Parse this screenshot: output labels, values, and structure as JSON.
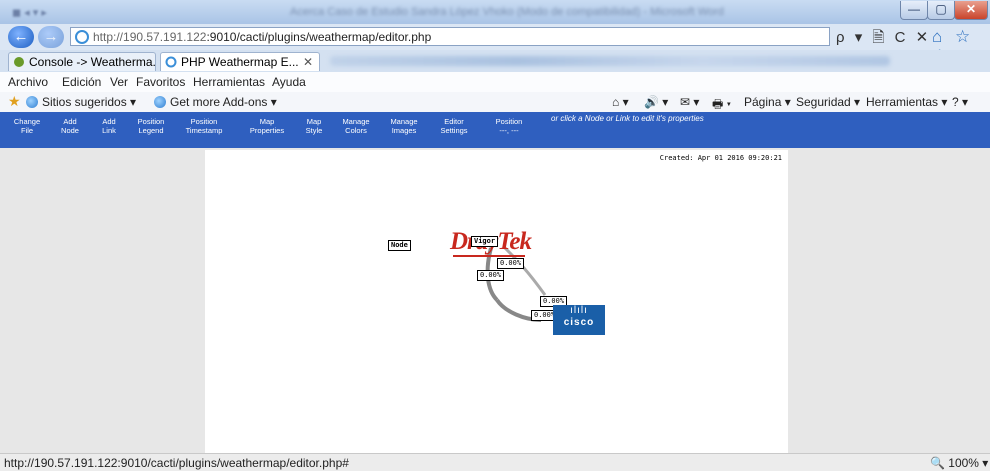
{
  "browser": {
    "tab_title_blurred": "Acerca Caso de Estudio Sandra López Vhoko (Modo de compatibilidad) - Microsoft Word",
    "url_host": "http://190.57.191.122",
    "url_path": ":9010/cacti/plugins/weathermap/editor.php",
    "window_buttons": {
      "minimize": "—",
      "maximize": "▢",
      "close": "✕"
    },
    "nav": {
      "back_icon": "←",
      "forward_icon": "→"
    },
    "addr_icons": "ρ ▾ 🗎 C ✕",
    "right_icons": "⌂ ☆ ⚙"
  },
  "tabs": [
    {
      "label": "Console -> Weatherma...",
      "icon": "cacti-icon"
    },
    {
      "label": "PHP Weathermap E...",
      "icon": "ie-icon",
      "close": "✕"
    }
  ],
  "menu": [
    "Archivo",
    "Edición",
    "Ver",
    "Favoritos",
    "Herramientas",
    "Ayuda"
  ],
  "favorites": {
    "items": [
      "Sitios sugeridos ▾",
      "Get more Add-ons ▾"
    ],
    "right": [
      "⌂ ▾",
      "🔊 ▾",
      "✉ ▾",
      "🖶 ▾",
      "Página ▾",
      "Seguridad ▾",
      "Herramientas ▾",
      "? ▾"
    ]
  },
  "toolbar": {
    "buttons": [
      {
        "l1": "Change",
        "l2": "File"
      },
      {
        "l1": "Add",
        "l2": "Node"
      },
      {
        "l1": "Add",
        "l2": "Link"
      },
      {
        "l1": "Position",
        "l2": "Legend"
      },
      {
        "l1": "Position",
        "l2": "Timestamp"
      },
      {
        "l1": "Map",
        "l2": "Properties"
      },
      {
        "l1": "Map",
        "l2": "Style"
      },
      {
        "l1": "Manage",
        "l2": "Colors"
      },
      {
        "l1": "Manage",
        "l2": "Images"
      },
      {
        "l1": "Editor",
        "l2": "Settings"
      },
      {
        "l1": "Position",
        "l2": "---, ---"
      }
    ],
    "hint": "or click a Node or Link to edit it's properties"
  },
  "map": {
    "created": "Created: Apr 01 2016 09:20:21",
    "node_label": "Node",
    "vigor_label": "Vigor",
    "drtek_logo": "DrayTek",
    "cisco_logo": "cisco",
    "link_labels": [
      "0.00%",
      "0.00%",
      "0.00%",
      "0.00%"
    ]
  },
  "status": {
    "text": "http://190.57.191.122:9010/cacti/plugins/weathermap/editor.php#",
    "zoom": "🔍 100%  ▾"
  }
}
